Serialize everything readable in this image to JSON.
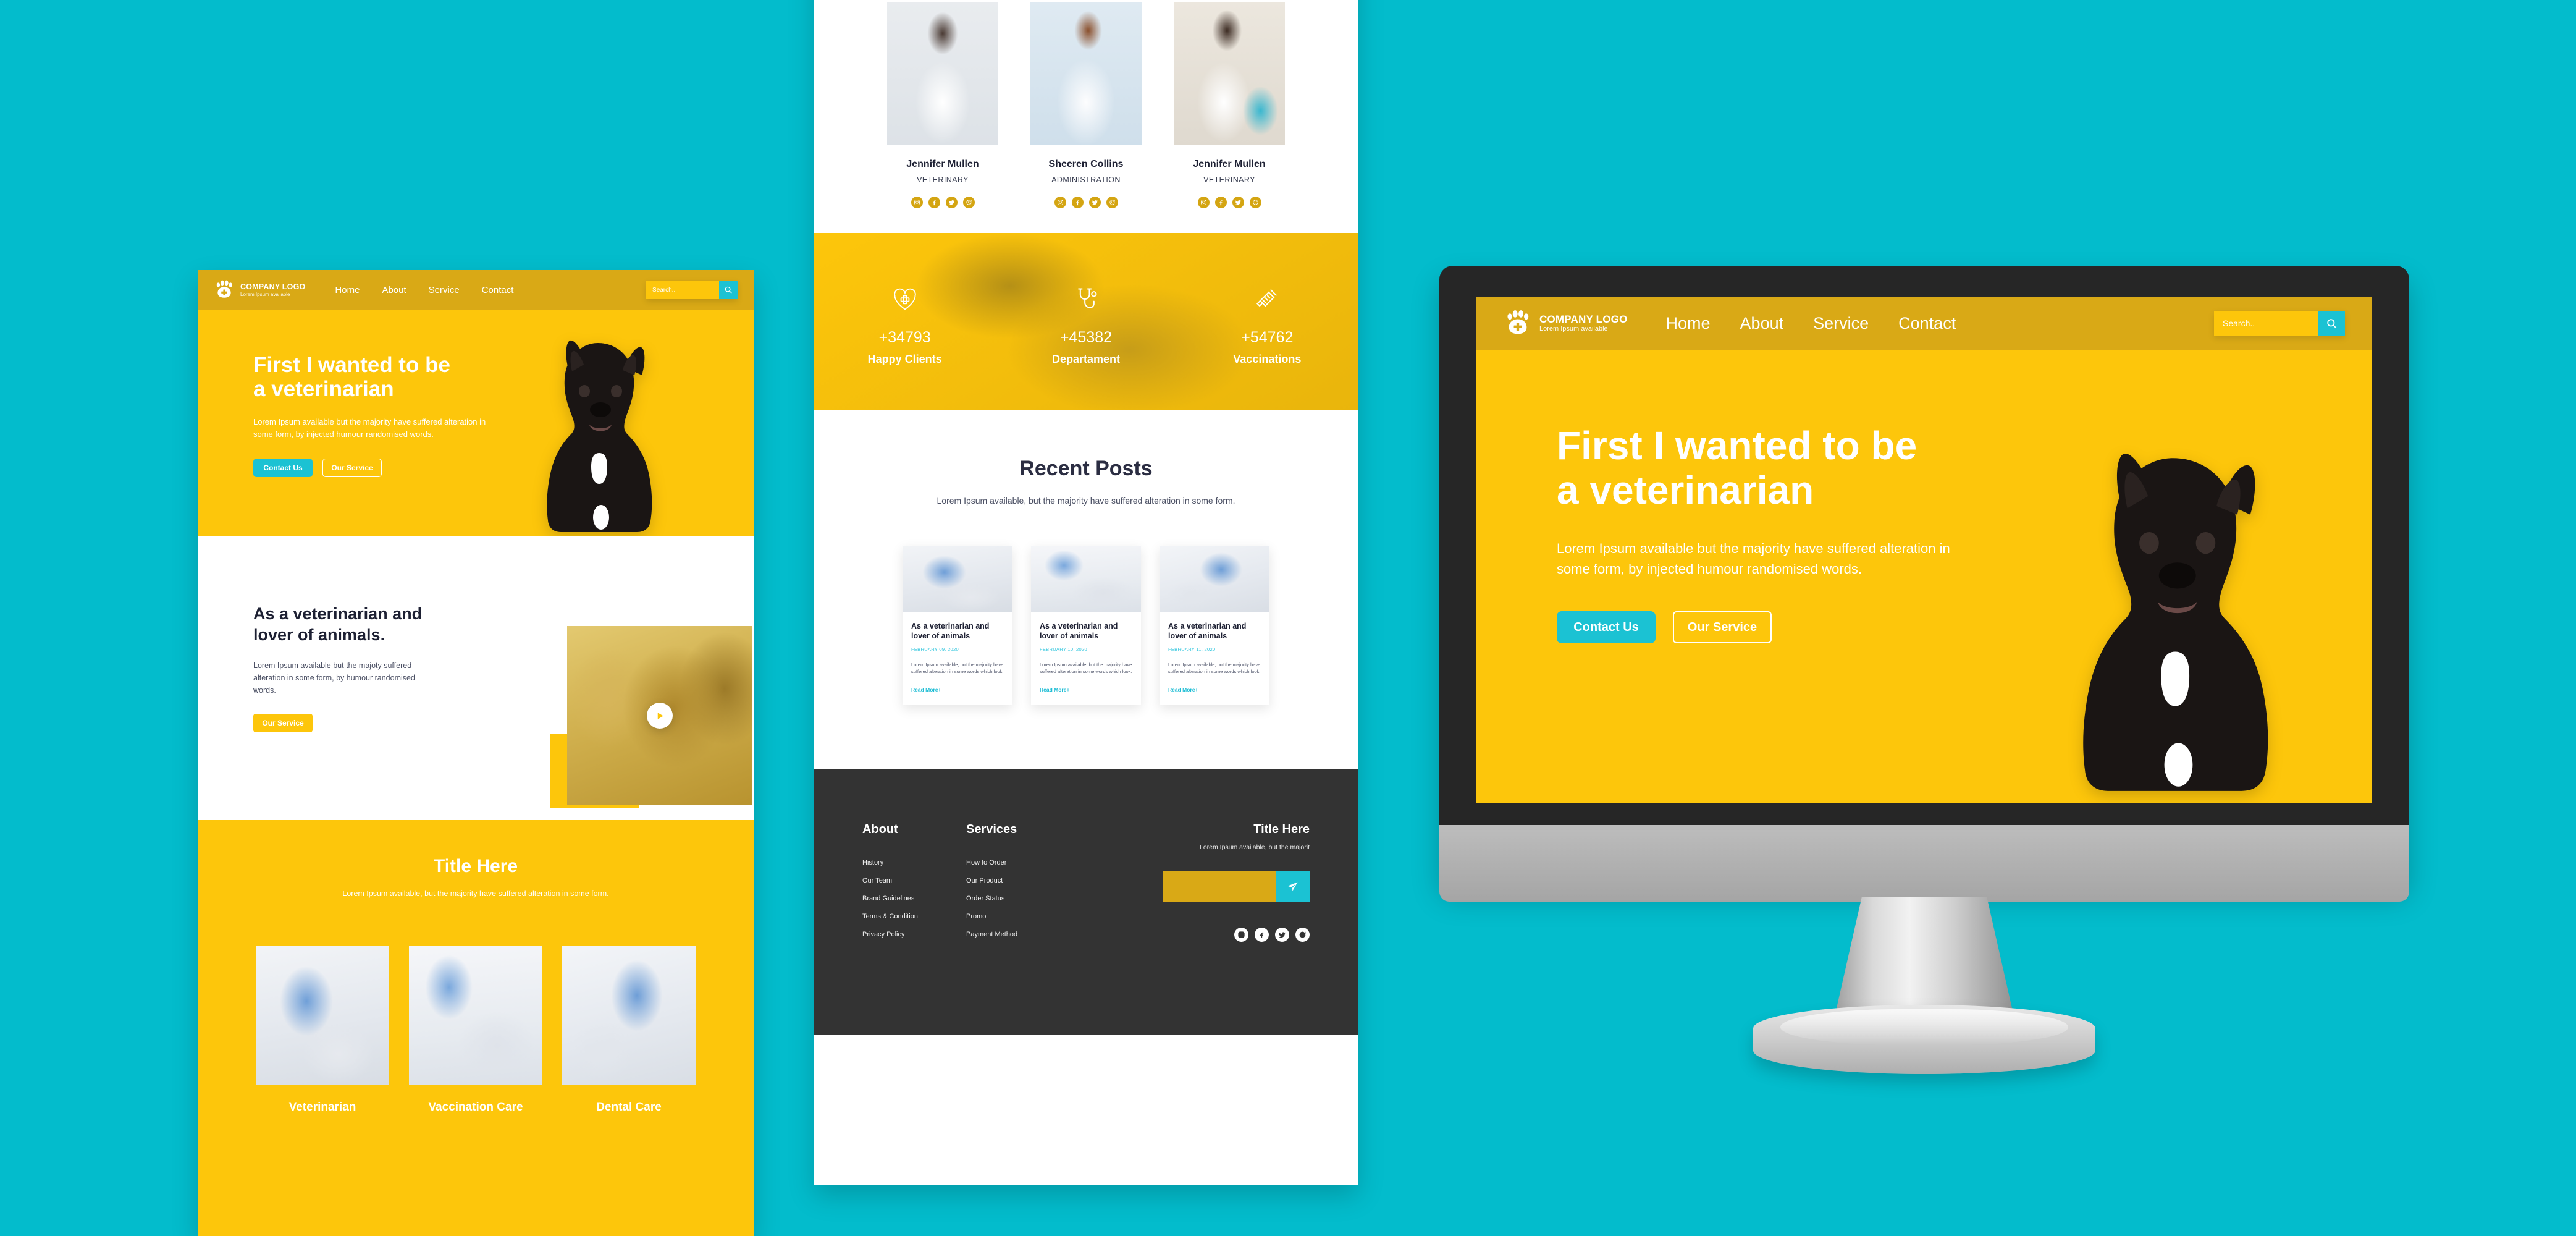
{
  "brand": {
    "logo_name": "COMPANY LOGO",
    "logo_sub": "Lorem Ipsum available",
    "accent_yellow": "#fdc60b",
    "accent_yellow_dark": "#d9a916",
    "accent_teal": "#1bc2d3",
    "background_cyan": "#03bccc",
    "dark": "#333333",
    "heading_navy": "#1d2033"
  },
  "nav": {
    "items": [
      "Home",
      "About",
      "Service",
      "Contact"
    ],
    "search_placeholder": "Search..",
    "search_value": "",
    "search_icon": "search-icon"
  },
  "hero": {
    "title_line1": "First I wanted to be",
    "title_line2": "a veterinarian",
    "paragraph": "Lorem Ipsum available but the majority have suffered alteration in some form, by injected humour randomised words.",
    "primary_button": "Contact Us",
    "secondary_button": "Our Service"
  },
  "about": {
    "title_line1": "As a veterinarian and",
    "title_line2": "lover of animals.",
    "paragraph": "Lorem Ipsum available but the majoty suffered alteration in some form, by humour randomised words.",
    "button": "Our Service",
    "play_icon": "play-icon"
  },
  "services": {
    "title": "Title Here",
    "subtitle": "Lorem Ipsum available, but the majority have suffered alteration in some form.",
    "items": [
      {
        "label": "Veterinarian",
        "image": "vet-examining-dog"
      },
      {
        "label": "Vaccination Care",
        "image": "gloved-hand-with-dog"
      },
      {
        "label": "Dental Care",
        "image": "vet-with-stethoscope-dog"
      }
    ]
  },
  "team": {
    "members": [
      {
        "name": "Jennifer Mullen",
        "role": "VETERINARY",
        "image": "asian-doctor-portrait"
      },
      {
        "name": "Sheeren Collins",
        "role": "ADMINISTRATION",
        "image": "doctor-with-clipboard"
      },
      {
        "name": "Jennifer Mullen",
        "role": "VETERINARY",
        "image": "curly-hair-doctor"
      }
    ],
    "social_icons": [
      "instagram-icon",
      "facebook-icon",
      "twitter-icon",
      "whatsapp-icon"
    ]
  },
  "stats": {
    "items": [
      {
        "icon": "heart-plus-icon",
        "number": "+34793",
        "label": "Happy Clients"
      },
      {
        "icon": "stethoscope-icon",
        "number": "+45382",
        "label": "Departament"
      },
      {
        "icon": "syringe-icon",
        "number": "+54762",
        "label": "Vaccinations"
      }
    ]
  },
  "posts": {
    "title": "Recent Posts",
    "subtitle": "Lorem Ipsum available, but the majority have suffered alteration in some form.",
    "cards": [
      {
        "title": "As a veterinarian and lover of animals",
        "date": "FEBRUARY 09, 2020",
        "text": "Lorem Ipsum available, but the majority have suffered alteration in some words which look.",
        "link": "Read More+",
        "image": "vet-examining-dog-on-table"
      },
      {
        "title": "As a veterinarian and lover of animals",
        "date": "FEBRUARY 10, 2020",
        "text": "Lorem Ipsum available, but the majority have suffered alteration in some words which look.",
        "link": "Read More+",
        "image": "vet-holding-dog-paw"
      },
      {
        "title": "As a veterinarian and lover of animals",
        "date": "FEBRUARY 11, 2020",
        "text": "Lorem Ipsum available, but the majority have suffered alteration in some words which look.",
        "link": "Read More+",
        "image": "vet-brushing-dog"
      }
    ]
  },
  "footer": {
    "about_title": "About",
    "about_links": [
      "History",
      "Our Team",
      "Brand Guidelines",
      "Terms & Condition",
      "Privacy Policy"
    ],
    "services_title": "Services",
    "services_links": [
      "How to Order",
      "Our Product",
      "Order Status",
      "Promo",
      "Payment Method"
    ],
    "newsletter_title": "Title Here",
    "newsletter_sub": "Lorem Ipsum available, but the majorit",
    "newsletter_value": "",
    "newsletter_placeholder": "",
    "send_icon": "send-icon",
    "social_icons": [
      "instagram-icon",
      "facebook-icon",
      "twitter-icon",
      "whatsapp-icon"
    ]
  }
}
